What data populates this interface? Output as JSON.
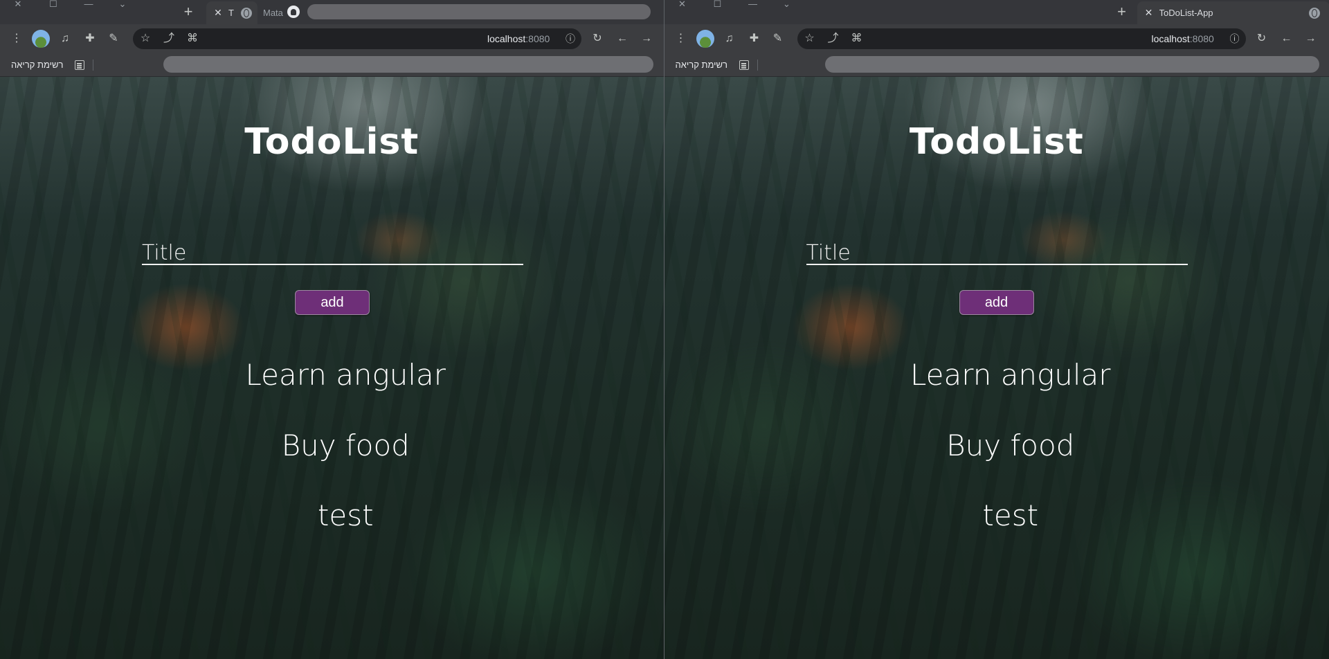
{
  "left_window": {
    "tabs": [
      {
        "label": "T",
        "active": true
      },
      {
        "label": "Mata",
        "active": false
      }
    ],
    "address": {
      "host": "localhost",
      "port": ":8080"
    },
    "bookmarks": {
      "reading_list_label": "רשימת קריאה"
    }
  },
  "right_window": {
    "tabs": [
      {
        "label": "ToDoList-App",
        "active": true
      }
    ],
    "address": {
      "host": "localhost",
      "port": ":8080"
    },
    "bookmarks": {
      "reading_list_label": "רשימת קריאה"
    }
  },
  "app": {
    "title": "TodoList",
    "title_input_placeholder": "Title",
    "add_button_label": "add",
    "todos": [
      "Learn angular",
      "Buy food",
      "test"
    ]
  },
  "colors": {
    "add_button": "#6e2f78",
    "browser_chrome": "#3c3d40",
    "tab_strip": "#35363a"
  }
}
